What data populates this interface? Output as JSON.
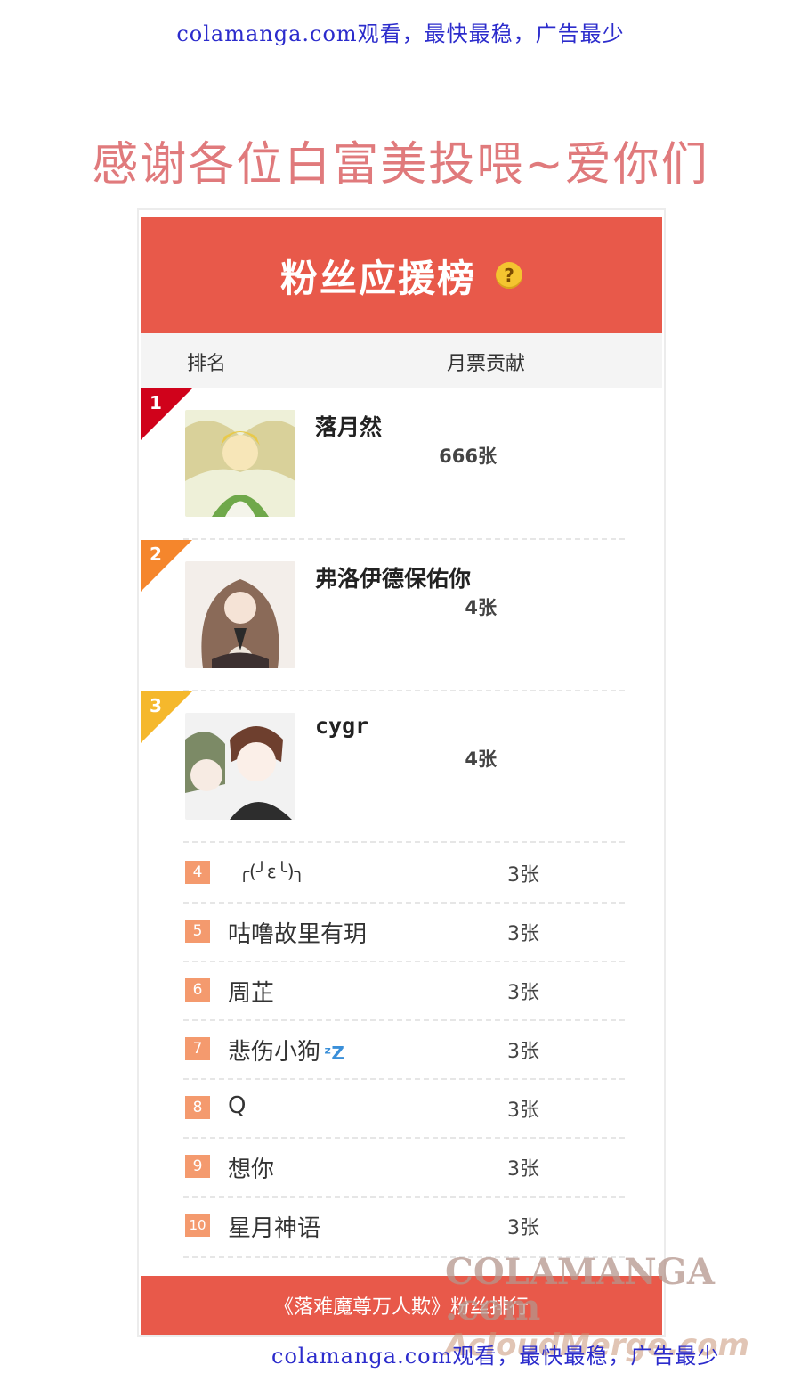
{
  "top_banner": "colamanga.com观看，最快最稳，广告最少",
  "thanks_title": "感谢各位白富美投喂~爱你们",
  "panel": {
    "title": "粉丝应援榜",
    "help_icon": "question-icon",
    "col_rank": "排名",
    "col_tickets": "月票贡献",
    "top3": [
      {
        "rank": "1",
        "name": "落月然",
        "count": "666张",
        "badge_color": "#d0021b"
      },
      {
        "rank": "2",
        "name": "弗洛伊德保佑你",
        "count": "4张",
        "badge_color": "#f5862c"
      },
      {
        "rank": "3",
        "name": "cygr",
        "count": "4张",
        "badge_color": "#f5b82c"
      }
    ],
    "rest": [
      {
        "rank": "4",
        "name": "╭(╯ε╰)╮",
        "count": "3张"
      },
      {
        "rank": "5",
        "name": "咕噜故里有玥",
        "count": "3张"
      },
      {
        "rank": "6",
        "name": "周芷",
        "count": "3张"
      },
      {
        "rank": "7",
        "name": "悲伤小狗",
        "count": "3张"
      },
      {
        "rank": "8",
        "name": "Q",
        "count": "3张"
      },
      {
        "rank": "9",
        "name": "想你",
        "count": "3张"
      },
      {
        "rank": "10",
        "name": "星月神语",
        "count": "3张"
      }
    ],
    "footer": "《落难魔尊万人欺》粉丝排行"
  },
  "watermark": {
    "line1": "COLAMANGA .com",
    "line2": "AcloudMerge.com"
  },
  "bottom_banner": "colamanga.com观看，最快最稳，广告最少",
  "colors": {
    "header_red": "#e8594a",
    "rank_box": "#f49a6e",
    "title_pink": "#e07a7c",
    "link_blue": "#2c2ccc"
  }
}
